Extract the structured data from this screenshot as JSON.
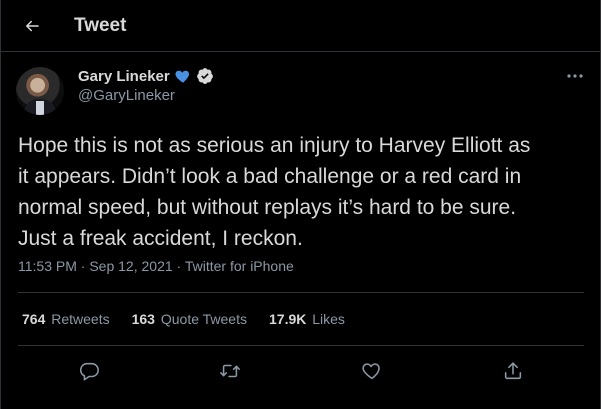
{
  "header": {
    "title": "Tweet"
  },
  "author": {
    "name": "Gary Lineker",
    "handle": "@GaryLineker"
  },
  "tweet": {
    "lines": [
      "Hope this is not as serious an injury to Harvey Elliott as",
      "it appears. Didn’t look a bad challenge or a red card in",
      "normal speed, but without replays it’s hard to be sure.",
      "Just a freak accident, I reckon."
    ]
  },
  "meta": {
    "time": "11:53 PM",
    "sep1": " · ",
    "date": "Sep 12, 2021",
    "sep2": " · ",
    "source": "Twitter for iPhone"
  },
  "stats": {
    "retweets": {
      "count": "764",
      "label": "Retweets"
    },
    "quotes": {
      "count": "163",
      "label": "Quote Tweets"
    },
    "likes": {
      "count": "17.9K",
      "label": "Likes"
    }
  },
  "colors": {
    "background": "#000000",
    "text": "#d9d9d9",
    "secondary": "#8b98a5",
    "border": "#2f3336",
    "heart_badge": "#4a90e2"
  },
  "icons": [
    "back-arrow-icon",
    "heart-badge-icon",
    "verified-icon",
    "more-icon",
    "reply-icon",
    "retweet-icon",
    "like-icon",
    "share-icon"
  ]
}
